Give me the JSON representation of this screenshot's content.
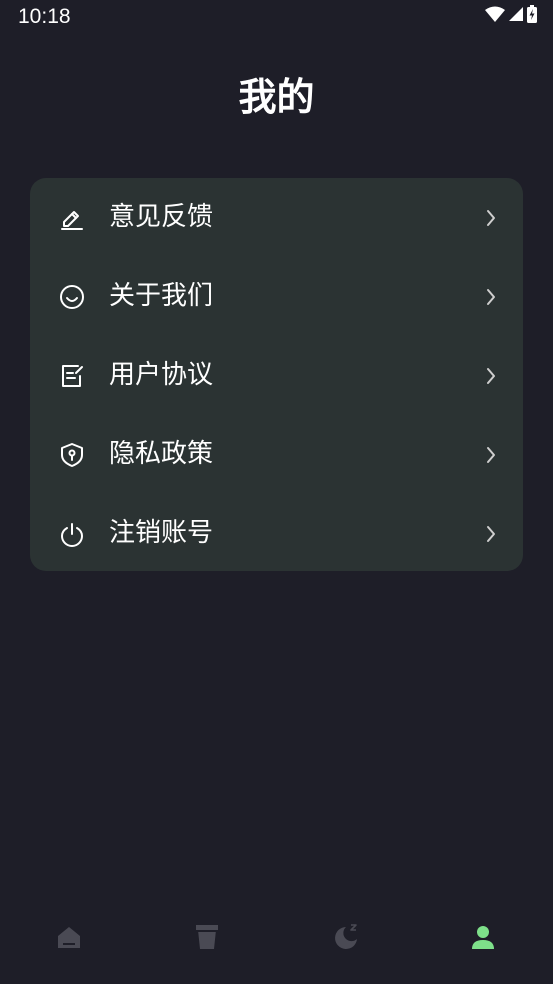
{
  "status_bar": {
    "time": "10:18",
    "icons": [
      "wifi-icon",
      "signal-icon",
      "battery-icon"
    ]
  },
  "header": {
    "title": "我的"
  },
  "menu": {
    "items": [
      {
        "label": "意见反馈",
        "icon": "edit-icon"
      },
      {
        "label": "关于我们",
        "icon": "smile-icon"
      },
      {
        "label": "用户协议",
        "icon": "document-icon"
      },
      {
        "label": "隐私政策",
        "icon": "shield-icon"
      },
      {
        "label": "注销账号",
        "icon": "power-icon"
      }
    ]
  },
  "bottom_nav": {
    "items": [
      {
        "icon": "home-icon",
        "active": false
      },
      {
        "icon": "cup-icon",
        "active": false
      },
      {
        "icon": "moon-sleep-icon",
        "active": false
      },
      {
        "icon": "user-icon",
        "active": true
      }
    ],
    "active_color": "#7ee08a",
    "inactive_color": "#4a4a54"
  },
  "colors": {
    "background": "#1e1e28",
    "card": "#2b3333",
    "text": "#ffffff"
  }
}
